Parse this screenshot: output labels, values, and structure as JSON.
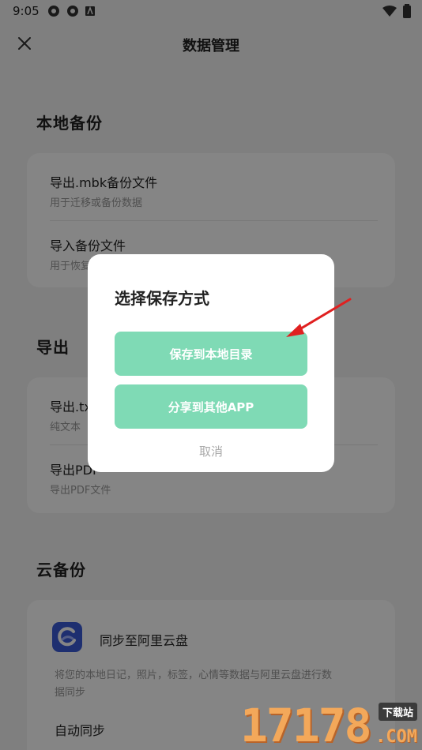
{
  "status": {
    "time": "9:05"
  },
  "header": {
    "title": "数据管理"
  },
  "local_backup": {
    "title": "本地备份",
    "items": [
      {
        "title": "导出.mbk备份文件",
        "sub": "用于迁移或备份数据"
      },
      {
        "title": "导入备份文件",
        "sub": "用于恢复数据"
      }
    ]
  },
  "export": {
    "title": "导出",
    "items": [
      {
        "title": "导出.txt",
        "sub": "纯文本"
      },
      {
        "title": "导出PDF",
        "sub": "导出PDF文件"
      }
    ]
  },
  "cloud": {
    "title": "云备份",
    "service": "同步至阿里云盘",
    "desc_line1": "将您的本地日记，照片，标签，心情等数据与阿里云盘进行数",
    "desc_line2": "据同步",
    "auto_sync": "自动同步"
  },
  "dialog": {
    "title": "选择保存方式",
    "save_local": "保存到本地目录",
    "share_app": "分享到其他APP",
    "cancel": "取消"
  },
  "watermark": {
    "number": "17178",
    "badge": "下载站",
    "com": ".COM"
  },
  "colors": {
    "accent": "#7fdab5",
    "arrow": "#e02020"
  }
}
